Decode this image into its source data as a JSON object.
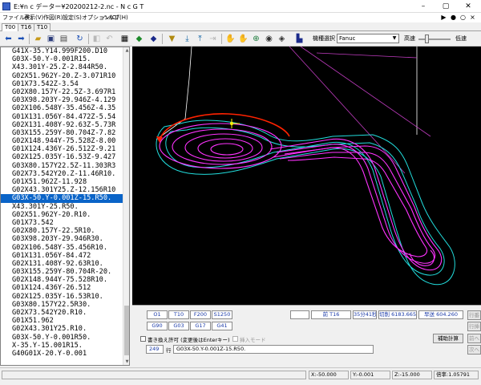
{
  "window": {
    "title": "E:¥n c データー¥20200212-2.nc - N c G T",
    "minimize": "–",
    "maximize": "▢",
    "close": "✕"
  },
  "menu": {
    "items": [
      "ファイル(F)",
      "表示(V)",
      "作図(R)",
      "設定(S)",
      "オプション(O)",
      "ヘルプ(H)"
    ],
    "right_controls": [
      "▶",
      "●",
      "○",
      "×"
    ]
  },
  "tabs": [
    "T00",
    "T16",
    "T10"
  ],
  "toolbar": {
    "machine_label": "機種選択",
    "machine_value": "Fanuc",
    "speed_high": "高速",
    "speed_low": "低速",
    "speed_level": 0.25
  },
  "code": {
    "selected_index": 19,
    "rows": [
      "G41X-35.Y14.999F200.D10",
      "G03X-50.Y-0.001R15.",
      "X43.301Y-25.Z-2.844R50.",
      "G02X51.962Y-20.Z-3.071R10.",
      "G01X73.542Z-3.54",
      "G02X80.157Y-22.5Z-3.697R10.",
      "G03X98.203Y-29.946Z-4.129R30.",
      "G02X106.548Y-35.456Z-4.354R10.",
      "G01X131.056Y-84.472Z-5.546",
      "G02X131.408Y-92.63Z-5.73R10.",
      "G03X155.259Y-80.704Z-7.826R20.",
      "G02X148.944Y-75.528Z-8.005R10.",
      "G01X124.436Y-26.512Z-9.216",
      "G02X125.035Y-16.53Z-9.427R10.",
      "G03X80.157Y22.5Z-11.303R30.",
      "G02X73.542Y20.Z-11.46R10.",
      "G01X51.962Z-11.928",
      "G02X43.301Y25.Z-12.156R10.",
      "G03X-50.Y-0.001Z-15.R50.",
      "G03X-50.Y-0.001Z-15.R50.",
      "X43.301Y-25.R50.",
      "G02X51.962Y-20.R10.",
      "G01X73.542",
      "G02X80.157Y-22.5R10.",
      "G03X98.203Y-29.946R30.",
      "G02X106.548Y-35.456R10.",
      "G01X131.056Y-84.472",
      "G02X131.408Y-92.63R10.",
      "G03X155.259Y-80.704R-20.",
      "G02X148.944Y-75.528R10.",
      "G01X124.436Y-26.512",
      "G02X125.035Y-16.53R10.",
      "G03X80.157Y22.5R30.",
      "G02X73.542Y20.R10.",
      "G01X51.962",
      "G02X43.301Y25.R10.",
      "G03X-50.Y-0.001R50.",
      "X-35.Y-15.001R15.",
      "G40G01X-20.Y-0.001"
    ],
    "visible_rows": [
      "G41X-35.Y14.999F200.D10",
      "G03X-50.Y-0.001R15.",
      "X43.301Y-25.Z-2.844R50.",
      "G02X51.962Y-20.Z-3.071R10",
      "G01X73.542Z-3.54",
      "G02X80.157Y-22.5Z-3.697R1",
      "G03X98.203Y-29.946Z-4.129",
      "G02X106.548Y-35.456Z-4.35",
      "G01X131.056Y-84.472Z-5.54",
      "G02X131.408Y-92.63Z-5.73R",
      "G03X155.259Y-80.704Z-7.82",
      "G02X148.944Y-75.528Z-8.00",
      "G01X124.436Y-26.512Z-9.21",
      "G02X125.035Y-16.53Z-9.427",
      "G03X80.157Y22.5Z-11.303R3",
      "G02X73.542Y20.Z-11.46R10.",
      "G01X51.962Z-11.928",
      "G02X43.301Y25.Z-12.156R10",
      "G03X-50.Y-0.001Z-15.R50.",
      "X43.301Y-25.R50.",
      "G02X51.962Y-20.R10.",
      "G01X73.542",
      "G02X80.157Y-22.5R10.",
      "G03X98.203Y-29.946R30.",
      "G02X106.548Y-35.456R10.",
      "G01X131.056Y-84.472",
      "G02X131.408Y-92.63R10.",
      "G03X155.259Y-80.704R-20.",
      "G02X148.944Y-75.528R10.",
      "G01X124.436Y-26.512",
      "G02X125.035Y-16.53R10.",
      "G03X80.157Y22.5R30.",
      "G02X73.542Y20.R10.",
      "G01X51.962",
      "G02X43.301Y25.R10.",
      "G03X-50.Y-0.001R50.",
      "X-35.Y-15.001R15.",
      "G40G01X-20.Y-0.001"
    ]
  },
  "modal": {
    "row1": [
      "O1",
      "T10",
      "F200",
      "S1250"
    ],
    "row2": [
      "G90",
      "G03",
      "G17",
      "G41"
    ]
  },
  "info": {
    "prev_tool": "前 T16",
    "time": "35分41秒",
    "cut_length": "切削 6183.665",
    "total_length": "早送 604.260"
  },
  "edit": {
    "overwrite_label": "書き換え許可 (変更後はEnterキー)",
    "insert_mode_label": "挿入モード",
    "line_number": "249",
    "line_label": "行",
    "current_line": "G03X-50.Y-0.001Z-15.R50.",
    "aux_calc_button": "補助計算"
  },
  "right_buttons": [
    "行番",
    "行挿",
    "前へ",
    "次へ"
  ],
  "status": {
    "x": "X:-50.000",
    "y": "Y:-0.001",
    "z": "Z:-15.000",
    "scale": "倍率:1.05791"
  },
  "colors": {
    "toolpath": "#ff33ff",
    "offset_outline": "#22dddd",
    "current_arc": "#ff2200",
    "rapid": "#ffffff",
    "selection": "#0a64c8"
  }
}
